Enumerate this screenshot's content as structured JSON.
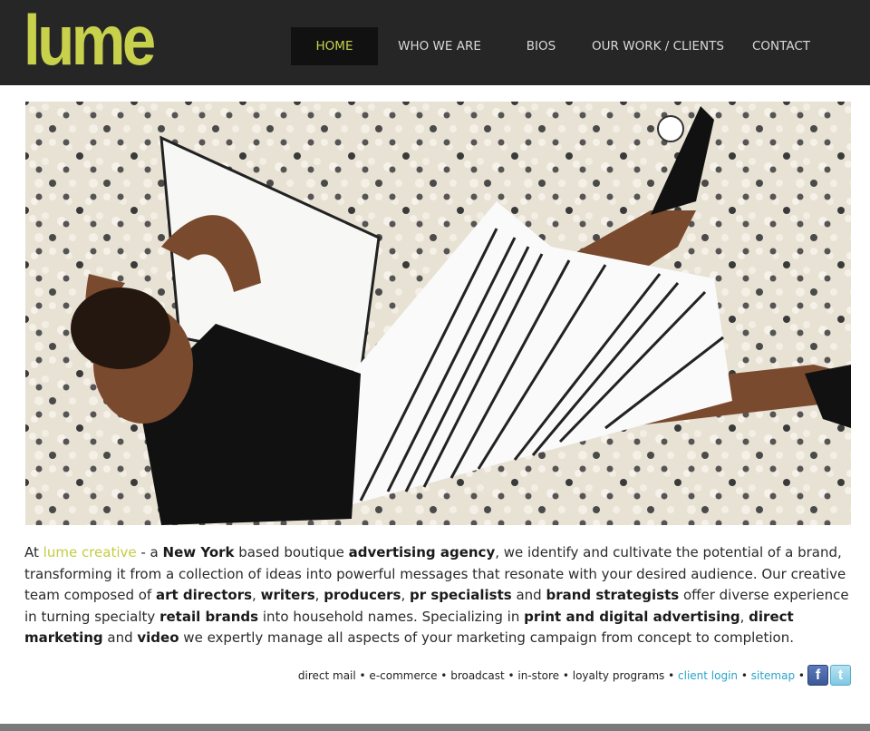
{
  "logo": {
    "text": "lume",
    "color": "#c8d14b"
  },
  "nav": {
    "items": [
      {
        "label": "HOME",
        "active": true
      },
      {
        "label": "WHO WE ARE",
        "active": false
      },
      {
        "label": "BIOS",
        "active": false
      },
      {
        "label": "OUR WORK / CLIENTS",
        "active": false
      },
      {
        "label": "CONTACT",
        "active": false
      }
    ]
  },
  "hero": {
    "image": "woman-reclining-on-pebble-mosaic-photo"
  },
  "intro": {
    "at": "At ",
    "brand": "lume creative",
    "t1": " - a ",
    "b1": "New York",
    "t2": " based boutique ",
    "b2": "advertising agency",
    "t3": ", we identify and cultivate the potential of a brand, transforming it from a collection of ideas into powerful messages that resonate with your desired audience. Our creative team composed of ",
    "b3": "art directors",
    "t4": ", ",
    "b4": "writers",
    "t5": ", ",
    "b5": "producers",
    "t6": ", ",
    "b6": "pr specialists",
    "t7": " and ",
    "b7": "brand strategists",
    "t8": " offer diverse experience in turning specialty ",
    "b8": "retail brands",
    "t9": " into household names. Specializing in ",
    "b9": "print and digital advertising",
    "t10": ", ",
    "b10": "direct marketing",
    "t11": " and ",
    "b11": "video",
    "t12": " we expertly manage all aspects of your marketing campaign from concept to completion."
  },
  "footer": {
    "services": "direct mail • e-commerce • broadcast • in-store • loyalty programs • ",
    "client_login": "client login",
    "sep": " • ",
    "sitemap": "sitemap",
    "sep2": " •",
    "facebook_icon": "f",
    "twitter_icon": "t"
  },
  "colors": {
    "accent": "#c8d14b",
    "link": "#2aa3c9",
    "header_bg": "#262626"
  }
}
